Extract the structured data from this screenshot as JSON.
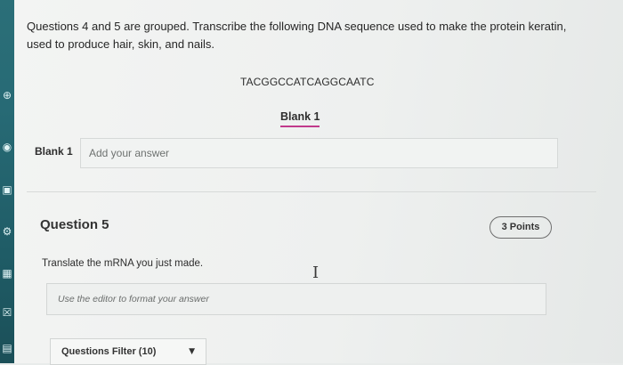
{
  "question_intro": {
    "text": "Questions 4 and 5 are grouped. Transcribe the following DNA sequence used to make the protein keratin, used to produce hair, skin, and nails."
  },
  "dna_sequence": "TACGGCCATCAGGCAATC",
  "blank_reference": "Blank 1",
  "answer": {
    "label": "Blank 1",
    "placeholder": "Add your answer",
    "value": ""
  },
  "question5": {
    "title": "Question 5",
    "points": "3 Points",
    "prompt": "Translate the mRNA you just made.",
    "editor_placeholder": "Use the editor to format your answer"
  },
  "filter": {
    "label": "Questions Filter (10)"
  },
  "left_toolbar_icons": [
    "accessibility-icon",
    "reader-icon",
    "translate-icon",
    "calculator-icon",
    "close-box-icon",
    "notes-icon"
  ]
}
